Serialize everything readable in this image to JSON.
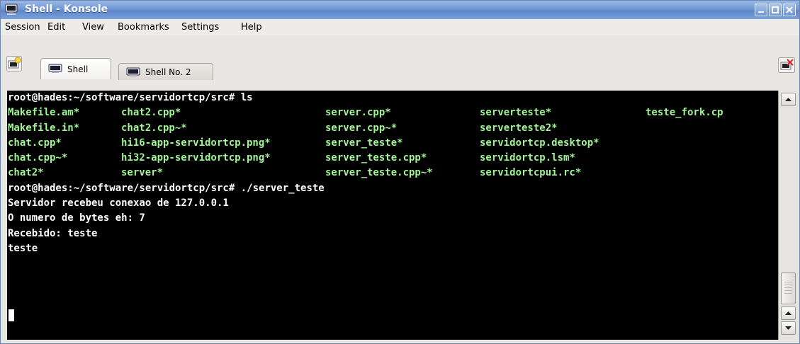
{
  "window": {
    "title": "Shell - Konsole"
  },
  "menu": [
    "Session",
    "Edit",
    "View",
    "Bookmarks",
    "Settings",
    "Help"
  ],
  "tabs": [
    {
      "label": "Shell",
      "active": true
    },
    {
      "label": "Shell No. 2",
      "active": false
    }
  ],
  "terminal": {
    "prompt1": "root@hades:~/software/servidortcp/src#",
    "cmd1": " ls",
    "files": [
      [
        "Makefile.am*",
        "chat2.cpp*",
        "server.cpp*",
        "serverteste*",
        "teste_fork.cp"
      ],
      [
        "Makefile.in*",
        "chat2.cpp~*",
        "server.cpp~*",
        "serverteste2*",
        ""
      ],
      [
        "chat.cpp*",
        "hi16-app-servidortcp.png*",
        "server_teste*",
        "servidortcp.desktop*",
        ""
      ],
      [
        "chat.cpp~*",
        "hi32-app-servidortcp.png*",
        "server_teste.cpp*",
        "servidortcp.lsm*",
        ""
      ],
      [
        "chat2*",
        "server*",
        "server_teste.cpp~*",
        "servidortcpui.rc*",
        ""
      ]
    ],
    "prompt2": "root@hades:~/software/servidortcp/src#",
    "cmd2": " ./server_teste",
    "output": [
      "Servidor recebeu conexao de 127.0.0.1",
      "O numero de bytes eh: 7",
      "Recebido: teste",
      "teste"
    ]
  },
  "colors": {
    "file_green": "#9ff593",
    "terminal_bg": "#000000",
    "titlebar": "#6f97d6"
  }
}
